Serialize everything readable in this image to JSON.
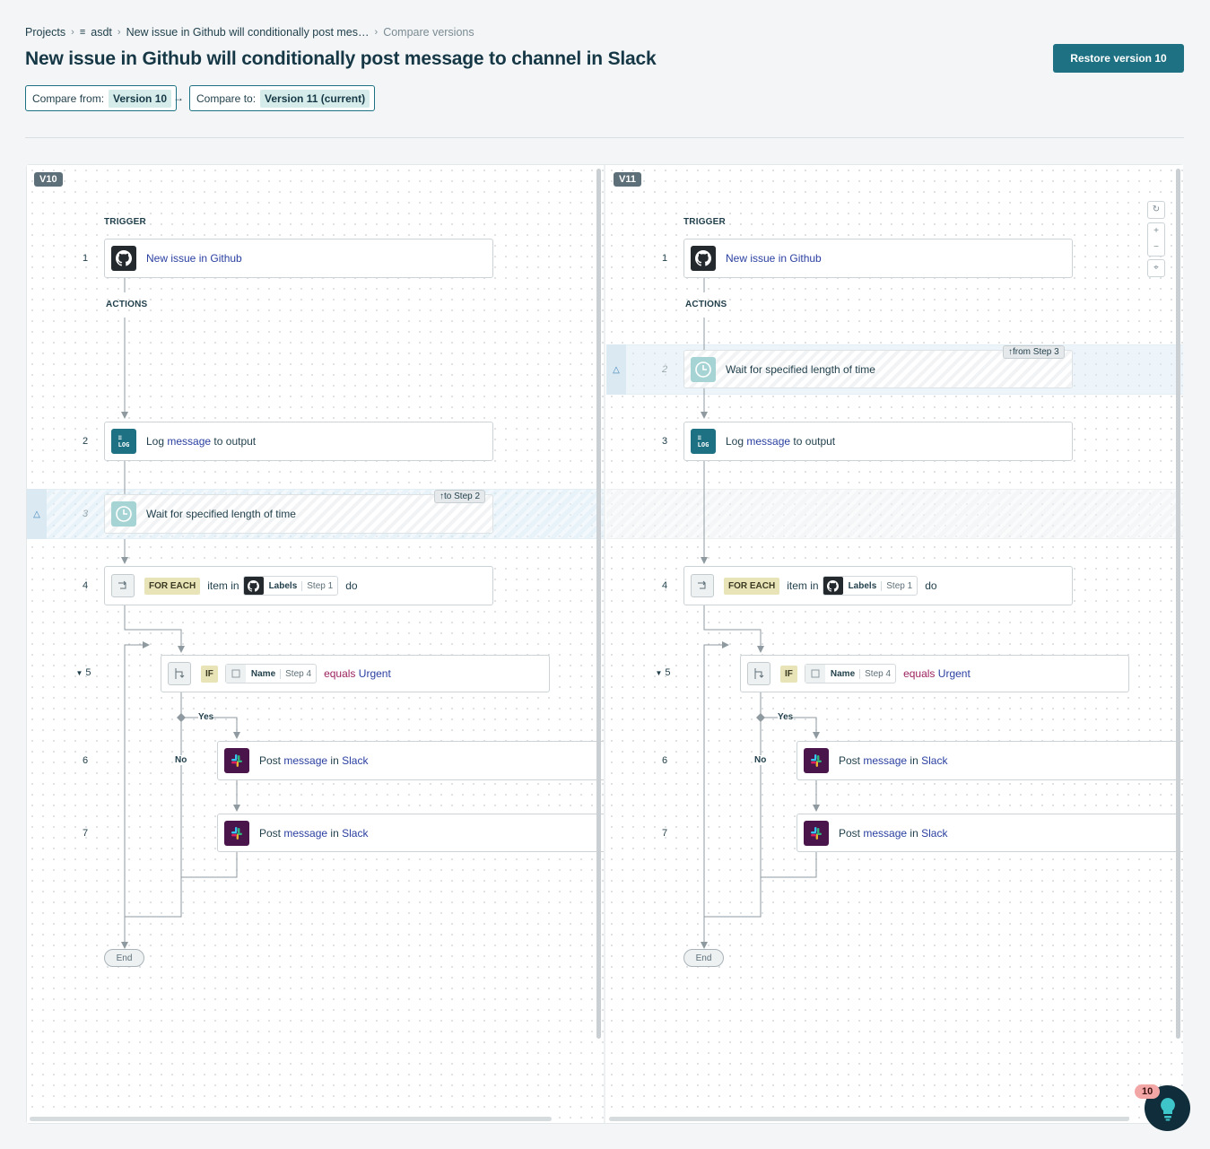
{
  "breadcrumb": {
    "projects": "Projects",
    "project": "asdt",
    "flow": "New issue in Github will conditionally post mes…",
    "current": "Compare versions"
  },
  "title": "New issue in Github will conditionally post message to channel in Slack",
  "restore_button": "Restore version 10",
  "compare_from": {
    "label": "Compare from:",
    "value": "Version 10"
  },
  "compare_to": {
    "label": "Compare to:",
    "value": "Version 11 (current)"
  },
  "left": {
    "badge": "V10",
    "trigger_label": "TRIGGER",
    "actions_label": "ACTIONS",
    "nums": {
      "s1": "1",
      "s2": "2",
      "s3": "3",
      "s4": "4",
      "s5": "5",
      "s6": "6",
      "s7": "7"
    },
    "moved_tag": "to Step 2",
    "end": "End"
  },
  "right": {
    "badge": "V11",
    "trigger_label": "TRIGGER",
    "actions_label": "ACTIONS",
    "nums": {
      "s1": "1",
      "s2": "2",
      "s3": "3",
      "s4": "4",
      "s5": "5",
      "s6": "6",
      "s7": "7"
    },
    "moved_tag": "from Step 3",
    "end": "End"
  },
  "steps": {
    "github": "New issue in Github",
    "log_pre": "Log",
    "log_link": "message",
    "log_post": "to output",
    "wait": "Wait for specified length of time",
    "foreach_kw": "FOR EACH",
    "foreach_pre": "item in",
    "foreach_pill_name": "Labels",
    "foreach_pill_step": "Step 1",
    "foreach_post": "do",
    "if_kw": "IF",
    "if_pill_name": "Name",
    "if_pill_step": "Step 4",
    "if_op": "equals",
    "if_val": "Urgent",
    "slack_pre": "Post",
    "slack_link": "message",
    "slack_mid": "in",
    "slack_app": "Slack",
    "yes": "Yes",
    "no": "No"
  },
  "notifications": "10",
  "colors": {
    "primary": "#1d7182",
    "link": "#2a3fa0",
    "operator": "#9c2361"
  }
}
